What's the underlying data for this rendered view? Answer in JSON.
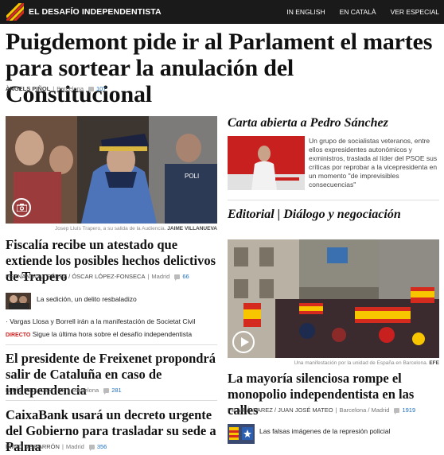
{
  "topbar": {
    "brand": "EL DESAFÍO INDEPENDENTISTA",
    "links": [
      "IN ENGLISH",
      "EN CATALÀ",
      "VER ESPECIAL"
    ],
    "flag_colors": [
      "#f7c600",
      "#d52b1e"
    ]
  },
  "main": {
    "headline": "Puigdemont pide ir al Parlament el martes para sortear la anulación del Constitucional",
    "author": "ÀNGELS PIÑOL",
    "location": "Barcelona",
    "comments": "107"
  },
  "left": {
    "photo_caption": "Josep Lluís Trapero, a su salida de la Audiencia.",
    "photo_credit": "JAIME VILLANUEVA",
    "story1_title": "Fiscalía recibe un atestado que extiende los posibles hechos delictivos de Trapero",
    "story1_author": "FERNANDO J. PÉREZ / ÓSCAR LÓPEZ-FONSECA",
    "story1_location": "Madrid",
    "story1_comments": "66",
    "related1": "La sedición, un delito resbaladizo",
    "related2": "Vargas Llosa y Borrell irán a la manifestación de Societat Civil",
    "live_label": "DIRECTO",
    "related3": "Sigue la última hora sobre el desafío independentista",
    "story2_title": "El presidente de Freixenet propondrá salir de Cataluña en caso de independencia",
    "story2_author": "LLUÍS PELLICER / EP",
    "story2_location": "Barcelona",
    "story2_comments": "281",
    "story3_title": "CaixaBank usará un decreto urgente del Gobierno para trasladar su sede a Palma",
    "story3_author": "ÍÑIGO DE BARRÓN",
    "story3_location": "Madrid",
    "story3_comments": "356"
  },
  "right": {
    "letter_title": "Carta abierta a Pedro Sánchez",
    "letter_text": "Un grupo de socialistas veteranos, entre ellos expresidentes autonómicos y exministros, traslada al líder del PSOE sus críticas por reprobar a la vicepresidenta en un momento \"de imprevisibles consecuencias\"",
    "editorial_title": "Editorial | Diálogo y negociación",
    "photo_caption": "Una manifestación por la unidad de España en Barcelona.",
    "photo_credit": "EFE",
    "story_title": "La mayoría silenciosa rompe el monopolio independentista en las calles",
    "story_author": "PILAR ÁLVAREZ / JUAN JOSÉ MATEO",
    "story_location": "Barcelona / Madrid",
    "story_comments": "1919",
    "related": "Las falsas imágenes de la represión policial"
  }
}
